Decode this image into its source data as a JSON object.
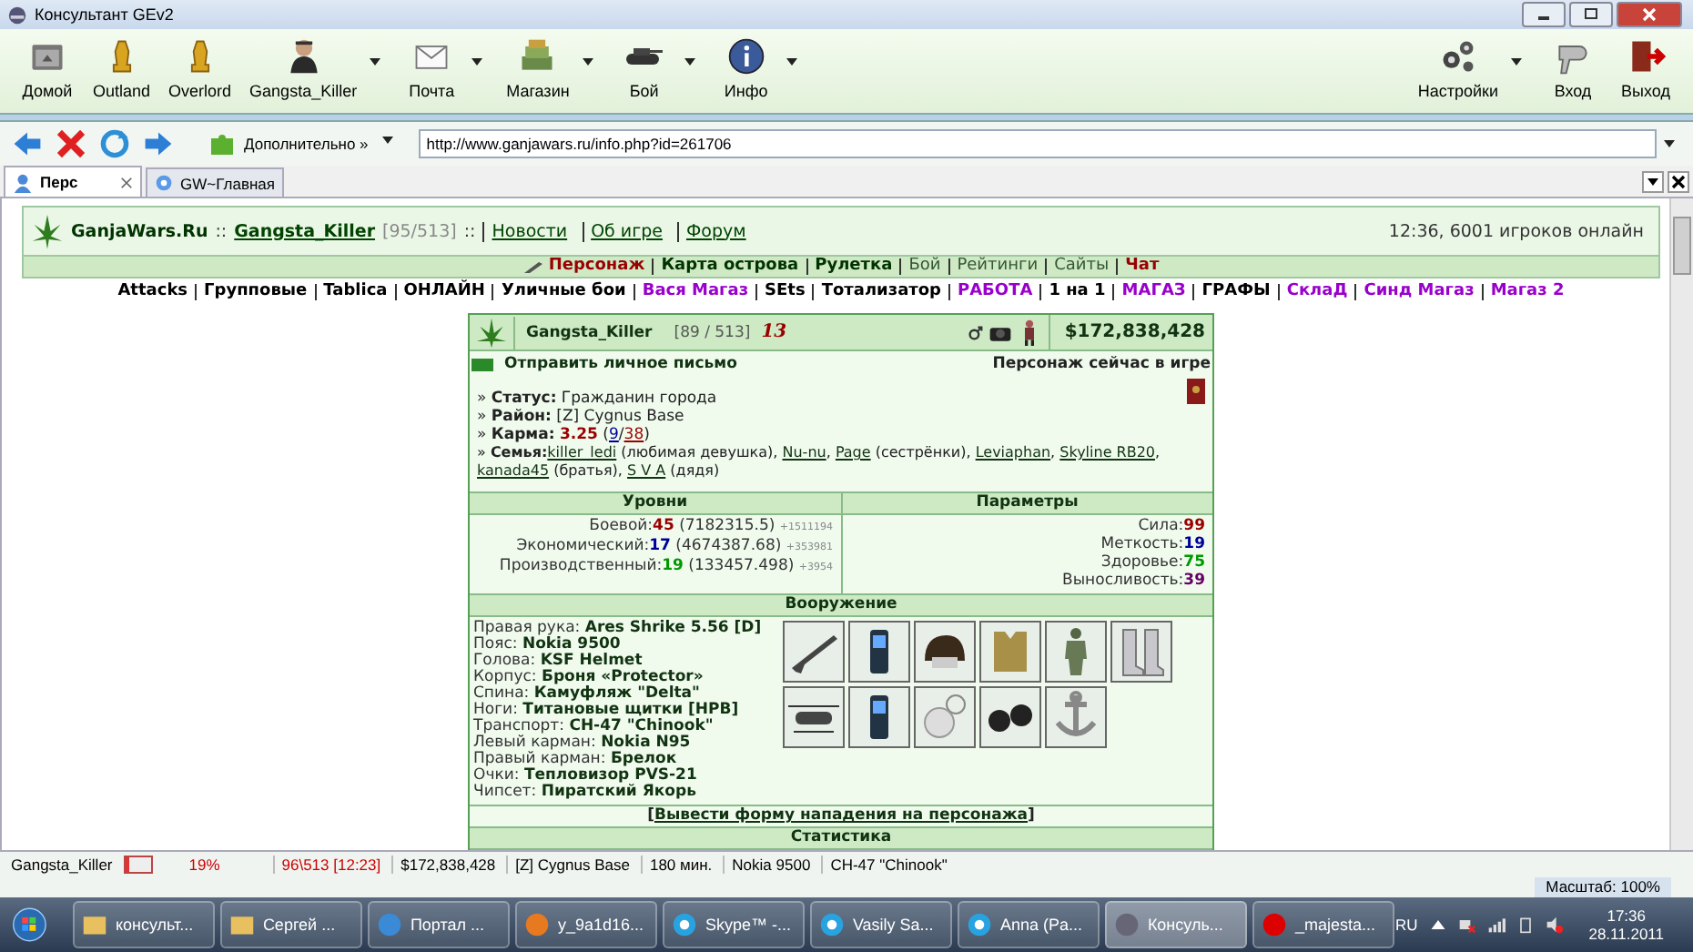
{
  "window": {
    "title": "Консультант GEv2"
  },
  "toolbar": {
    "left": [
      {
        "label": "Домой",
        "dropdown": false
      },
      {
        "label": "Outland",
        "dropdown": false
      },
      {
        "label": "Overlord",
        "dropdown": false
      },
      {
        "label": "Gangsta_Killer",
        "dropdown": true
      },
      {
        "label": "Почта",
        "dropdown": true
      },
      {
        "label": "Магазин",
        "dropdown": true
      },
      {
        "label": "Бой",
        "dropdown": true
      },
      {
        "label": "Инфо",
        "dropdown": true
      }
    ],
    "right": [
      {
        "label": "Настройки",
        "dropdown": true
      },
      {
        "label": "Вход",
        "dropdown": false
      },
      {
        "label": "Выход",
        "dropdown": false
      }
    ]
  },
  "navbar": {
    "menu": "Дополнительно »",
    "address": "http://www.ganjawars.ru/info.php?id=261706"
  },
  "tabs": [
    {
      "label": "Перс",
      "selected": true,
      "closable": true
    },
    {
      "label": "GW~Главная",
      "selected": false,
      "closable": false
    }
  ],
  "page": {
    "header": {
      "site": "GanjaWars.Ru",
      "separator": "::",
      "user": "Gangsta_Killer",
      "level": "[95/513]",
      "separator2": "::",
      "links": [
        "Новости",
        "Об игре",
        "Форум"
      ],
      "online": "12:36, 6001 игроков онлайн"
    },
    "menu": [
      {
        "label": "Персонаж",
        "kind": "active"
      },
      {
        "label": "Карта острова",
        "kind": "bold"
      },
      {
        "label": "Рулетка",
        "kind": "bold"
      },
      {
        "label": "Бой",
        "kind": "plain"
      },
      {
        "label": "Рейтинги",
        "kind": "plain"
      },
      {
        "label": "Сайты",
        "kind": "plain"
      },
      {
        "label": "Чат",
        "kind": "red"
      }
    ],
    "links": [
      {
        "label": "Attacks",
        "color": "#000000"
      },
      {
        "label": "Групповые",
        "color": "#000000"
      },
      {
        "label": "Tablica",
        "color": "#000000"
      },
      {
        "label": "ОНЛАЙН",
        "color": "#000000"
      },
      {
        "label": "Уличные бои",
        "color": "#000000"
      },
      {
        "label": "Вася Магаз",
        "color": "#9900cc"
      },
      {
        "label": "SEts",
        "color": "#000000"
      },
      {
        "label": "Тотализатор",
        "color": "#000000"
      },
      {
        "label": "РАБОТА",
        "color": "#9900cc"
      },
      {
        "label": "1 на 1",
        "color": "#000000"
      },
      {
        "label": "МАГАЗ",
        "color": "#9900cc"
      },
      {
        "label": "ГРАФЫ",
        "color": "#000000"
      },
      {
        "label": "СклаД",
        "color": "#9900cc"
      },
      {
        "label": "Синд Магаз",
        "color": "#9900cc"
      },
      {
        "label": "Магаз 2",
        "color": "#9900cc"
      }
    ],
    "card": {
      "bullet": "»",
      "name": "Gangsta_Killer",
      "level": "[89 / 513]",
      "badge": "13",
      "money": "$172,838,428",
      "send_message": "Отправить личное письмо",
      "online_status": "Персонаж сейчас в игре",
      "status": {
        "label": "Статус:",
        "value": "Гражданин города"
      },
      "district": {
        "label": "Район:",
        "value": "[Z] Cygnus Base"
      },
      "karma": {
        "label": "Карма:",
        "value": "3.25",
        "open": "(",
        "positive": "9",
        "slash": "/",
        "negative": "38",
        "close": ")"
      },
      "family": {
        "label": "Семья:",
        "members": [
          {
            "name": "killer_ledi",
            "after": " (любимая девушка),"
          },
          {
            "name": "Nu-nu",
            "after": ","
          },
          {
            "name": "Page",
            "after": " (сестрёнки),"
          },
          {
            "name": "Leviaphan",
            "after": ","
          },
          {
            "name": "Skyline RB20",
            "after": ","
          },
          {
            "name": "kanada45",
            "after": " (братья),"
          },
          {
            "name": "S V A",
            "after": " (дядя)"
          }
        ]
      }
    },
    "levels": {
      "title": "Уровни",
      "rows": [
        {
          "label": "Боевой:",
          "value": "45",
          "exp": "(7182315.5)",
          "gain": "+1511194",
          "color": "#990000"
        },
        {
          "label": "Экономический:",
          "value": "17",
          "exp": "(4674387.68)",
          "gain": "+353981",
          "color": "#000099"
        },
        {
          "label": "Производственный:",
          "value": "19",
          "exp": "(133457.498)",
          "gain": "+3954",
          "color": "#009900"
        }
      ]
    },
    "params": {
      "title": "Параметры",
      "rows": [
        {
          "label": "Сила:",
          "value": "99",
          "color": "#990000"
        },
        {
          "label": "Меткость:",
          "value": "19",
          "color": "#000099"
        },
        {
          "label": "Здоровье:",
          "value": "75",
          "color": "#009900"
        },
        {
          "label": "Выносливость:",
          "value": "39",
          "color": "#660066"
        }
      ]
    },
    "weapons": {
      "title": "Вооружение",
      "slots": [
        {
          "label": "Правая рука:",
          "value": "Ares Shrike 5.56 [D]"
        },
        {
          "label": "Пояс:",
          "value": "Nokia 9500"
        },
        {
          "label": "Голова:",
          "value": "KSF Helmet"
        },
        {
          "label": "Корпус:",
          "value": "Броня «Protector»"
        },
        {
          "label": "Спина:",
          "value": "Камуфляж \"Delta\""
        },
        {
          "label": "Ноги:",
          "value": "Титановые щитки [HPB]"
        },
        {
          "label": "Транспорт:",
          "value": "CH-47 \"Chinook\""
        },
        {
          "label": "Левый карман:",
          "value": "Nokia N95"
        },
        {
          "label": "Правый карман:",
          "value": "Брелок"
        },
        {
          "label": "Очки:",
          "value": "Тепловизор PVS-21"
        },
        {
          "label": "Чипсет:",
          "value": "Пиратский Якорь"
        }
      ],
      "attack": {
        "before": "[",
        "link": "Вывести форму нападения на персонажа",
        "after": "]"
      }
    },
    "stats": {
      "title": "Статистика"
    }
  },
  "status_bar": {
    "name": "Gangsta_Killer",
    "health": {
      "text": "19%",
      "level": 0.19
    },
    "hp_time": "96\\513 [12:23]",
    "money": "$172,838,428",
    "district": "[Z] Cygnus Base",
    "time": "180 мин.",
    "belt": "Nokia 9500",
    "transport": "CH-47 \"Chinook\"",
    "zoom": "Масштаб: 100%"
  },
  "taskbar": {
    "items": [
      {
        "label": "консульт...",
        "selected": false
      },
      {
        "label": "Сергей ...",
        "selected": false
      },
      {
        "label": "Портал ...",
        "selected": false
      },
      {
        "label": "y_9a1d16...",
        "selected": false
      },
      {
        "label": "Skype™ -...",
        "selected": false
      },
      {
        "label": "Vasily Sa...",
        "selected": false
      },
      {
        "label": "Anna (Pa...",
        "selected": false
      },
      {
        "label": "Консуль...",
        "selected": true
      },
      {
        "label": "_majesta...",
        "selected": false
      }
    ],
    "language": "RU",
    "time": "17:36",
    "date": "28.11.2011"
  }
}
